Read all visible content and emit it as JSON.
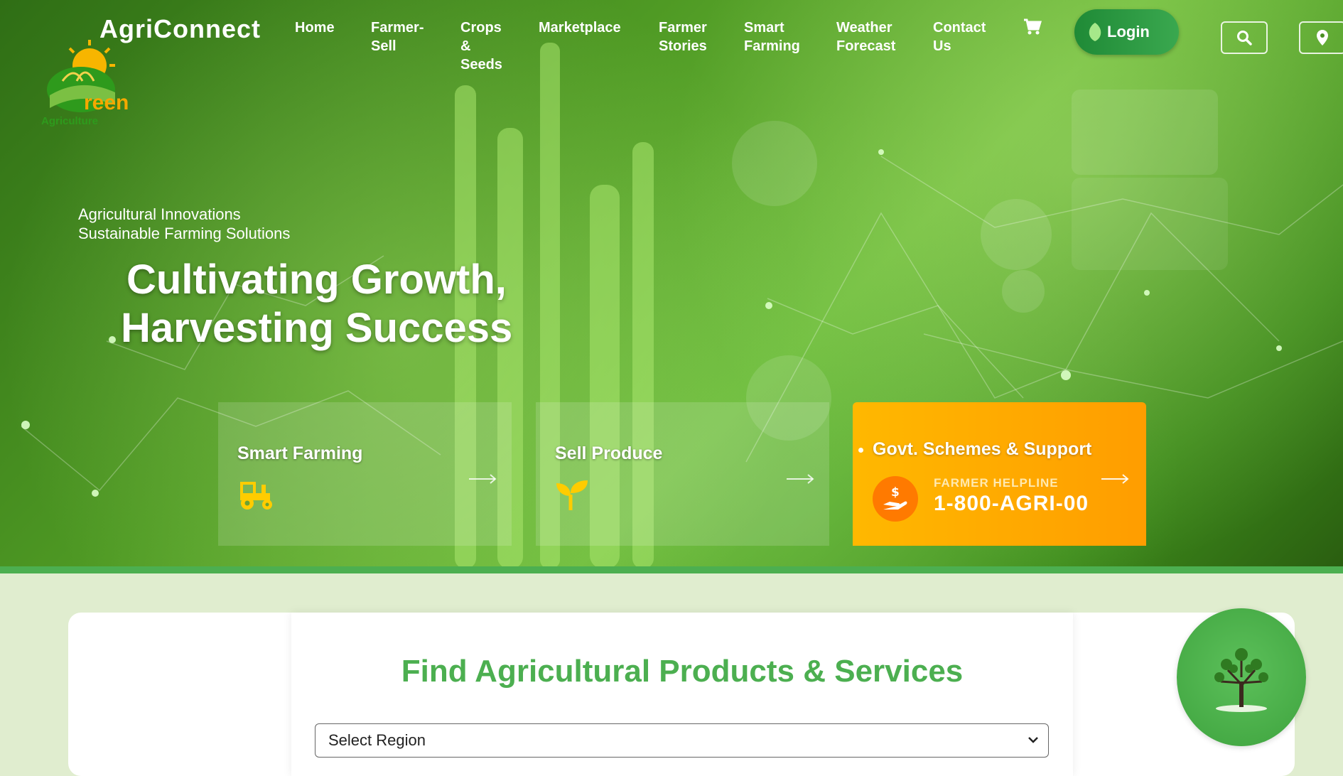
{
  "brand": {
    "name": "AgriConnect",
    "logo_word": "reen",
    "logo_sub": "Agriculture"
  },
  "nav": {
    "items": [
      {
        "label": "Home"
      },
      {
        "label": "Farmer-\nSell"
      },
      {
        "label": "Crops\n&\nSeeds"
      },
      {
        "label": "Marketplace"
      },
      {
        "label": "Farmer\nStories"
      },
      {
        "label": "Smart\nFarming"
      },
      {
        "label": "Weather\nForecast"
      },
      {
        "label": "Contact\nUs"
      }
    ],
    "login_label": "Login"
  },
  "hero": {
    "eyebrow_line1": "Agricultural Innovations",
    "eyebrow_line2": "Sustainable Farming Solutions",
    "headline_line1": "Cultivating Growth,",
    "headline_line2": "Harvesting Success"
  },
  "cards": {
    "smart_farming": "Smart Farming",
    "sell_produce": "Sell Produce",
    "schemes_title": "Govt. Schemes & Support",
    "helpline_label": "FARMER HELPLINE",
    "helpline_number": "1-800-AGRI-00"
  },
  "search_section": {
    "title": "Find Agricultural Products & Services",
    "region_selected": "Select Region"
  },
  "icons": {
    "cart": "cart-icon",
    "search": "search-icon",
    "location": "map-pin-icon",
    "tractor": "tractor-icon",
    "sprout": "sprout-icon",
    "helpline": "hand-dollar-icon",
    "tree": "tree-icon"
  },
  "colors": {
    "primary_green": "#4caf50",
    "login_green": "#1f8a36",
    "accent_orange": "#ffb800",
    "section_bg": "#e0edcf"
  }
}
